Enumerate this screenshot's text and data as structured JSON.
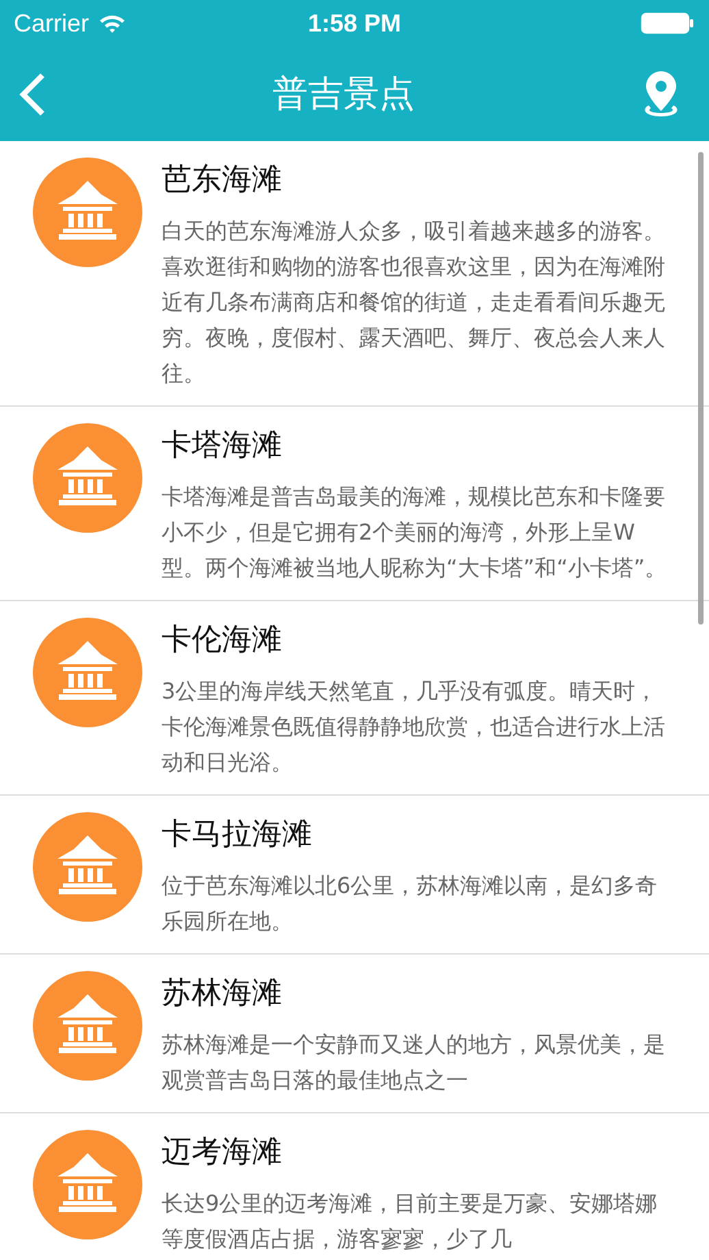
{
  "status_bar": {
    "carrier": "Carrier",
    "time": "1:58 PM"
  },
  "nav_bar": {
    "title": "普吉景点"
  },
  "places": [
    {
      "name": "芭东海滩",
      "description": "白天的芭东海滩游人众多，吸引着越来越多的游客。喜欢逛街和购物的游客也很喜欢这里，因为在海滩附近有几条布满商店和餐馆的街道，走走看看间乐趣无穷。夜晚，度假村、露天酒吧、舞厅、夜总会人来人往。"
    },
    {
      "name": "卡塔海滩",
      "description": "卡塔海滩是普吉岛最美的海滩，规模比芭东和卡隆要小不少，但是它拥有2个美丽的海湾，外形上呈W型。两个海滩被当地人昵称为“大卡塔”和“小卡塔”。"
    },
    {
      "name": "卡伦海滩",
      "description": "3公里的海岸线天然笔直，几乎没有弧度。晴天时，卡伦海滩景色既值得静静地欣赏，也适合进行水上活动和日光浴。"
    },
    {
      "name": "卡马拉海滩",
      "description": "位于芭东海滩以北6公里，苏林海滩以南，是幻多奇乐园所在地。"
    },
    {
      "name": "苏林海滩",
      "description": "苏林海滩是一个安静而又迷人的地方，风景优美，是观赏普吉岛日落的最佳地点之一"
    },
    {
      "name": "迈考海滩",
      "description": "长达9公里的迈考海滩，目前主要是万豪、安娜塔娜等度假酒店占据，游客寥寥，少了几"
    }
  ]
}
